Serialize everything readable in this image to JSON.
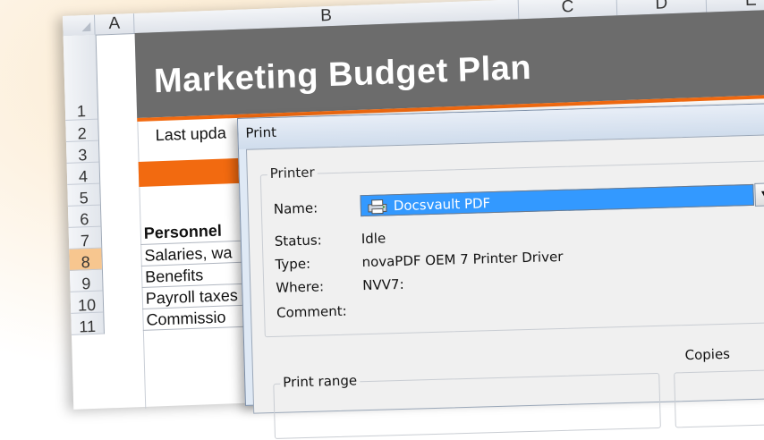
{
  "spreadsheet": {
    "columns": [
      "A",
      "B",
      "C",
      "D",
      "E"
    ],
    "rows": [
      "1",
      "2",
      "3",
      "4",
      "5",
      "6",
      "7",
      "8",
      "9",
      "10",
      "11"
    ],
    "selected_row": "8",
    "title": "Marketing Budget Plan",
    "cells": {
      "last_updated": "Last upda",
      "personnel": "Personnel",
      "salaries": "Salaries, wa",
      "benefits": "Benefits",
      "payroll": "Payroll taxes",
      "commissions": "Commissio"
    },
    "colors": {
      "banner": "#6c6c6c",
      "accent": "#f26a10",
      "row_selected": "#f7c68f"
    }
  },
  "print_dialog": {
    "title": "Print",
    "printer_group": "Printer",
    "name_label": "Name:",
    "printer_name": "Docsvault PDF",
    "status_label": "Status:",
    "status_value": "Idle",
    "type_label": "Type:",
    "type_value": "novaPDF OEM 7 Printer Driver",
    "where_label": "Where:",
    "where_value": "NVV7:",
    "comment_label": "Comment:",
    "print_range_label": "Print range",
    "copies_label": "Copies",
    "dropdown_icon": "chevron-down-icon",
    "printer_icon": "printer-icon"
  }
}
